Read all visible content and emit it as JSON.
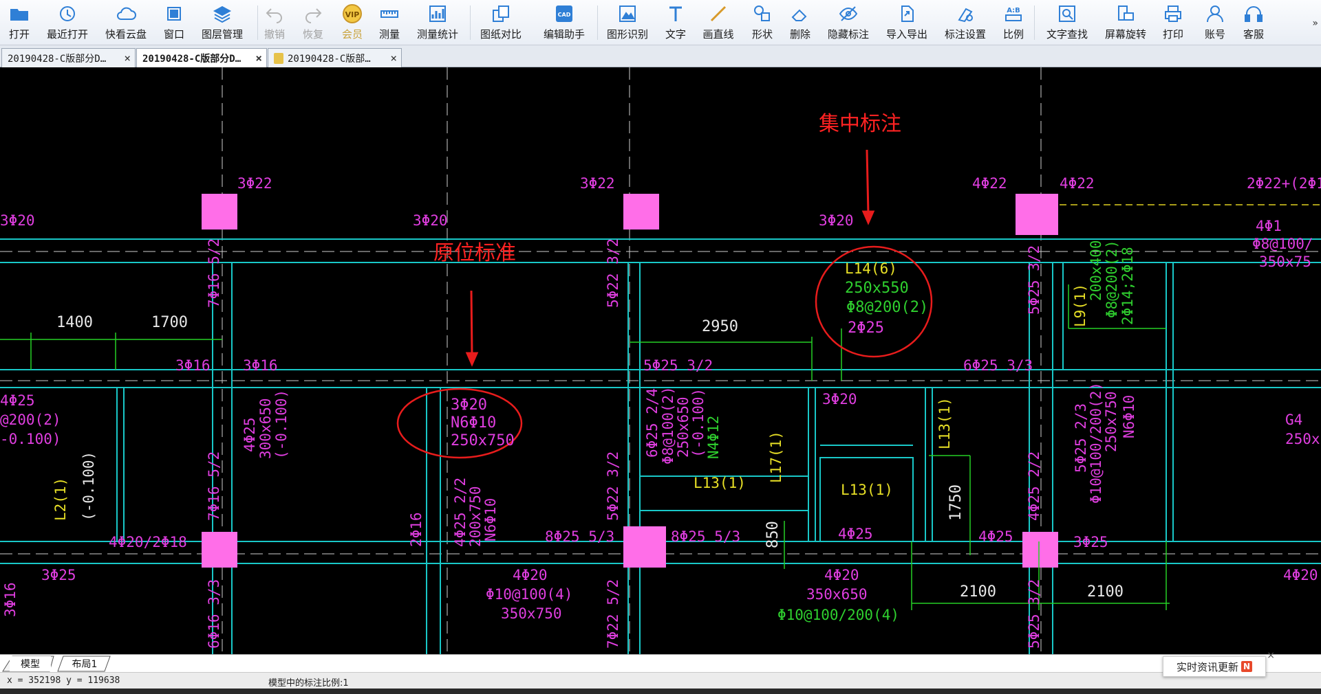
{
  "toolbar": {
    "buttons": [
      {
        "label": "打开",
        "icon": "folder-open-icon"
      },
      {
        "label": "最近打开",
        "icon": "history-icon"
      },
      {
        "label": "快看云盘",
        "icon": "cloud-icon"
      },
      {
        "label": "窗口",
        "icon": "window-icon"
      },
      {
        "label": "图层管理",
        "icon": "layers-icon"
      },
      {
        "label": "撤销",
        "icon": "undo-icon"
      },
      {
        "label": "恢复",
        "icon": "redo-icon"
      },
      {
        "label": "会员",
        "icon": "vip-icon",
        "badge": "VIP"
      },
      {
        "label": "测量",
        "icon": "ruler-icon"
      },
      {
        "label": "测量统计",
        "icon": "measure-stats-icon"
      },
      {
        "label": "图纸对比",
        "icon": "compare-icon"
      },
      {
        "label": "编辑助手",
        "icon": "cad-edit-icon",
        "badge": "CAD"
      },
      {
        "label": "图形识别",
        "icon": "shape-recognize-icon"
      },
      {
        "label": "文字",
        "icon": "text-icon"
      },
      {
        "label": "画直线",
        "icon": "line-icon"
      },
      {
        "label": "形状",
        "icon": "shapes-icon"
      },
      {
        "label": "删除",
        "icon": "eraser-icon"
      },
      {
        "label": "隐藏标注",
        "icon": "hide-eye-icon"
      },
      {
        "label": "导入导出",
        "icon": "import-export-icon"
      },
      {
        "label": "标注设置",
        "icon": "annotation-settings-icon"
      },
      {
        "label": "比例",
        "icon": "scale-icon",
        "badge": "A:B"
      },
      {
        "label": "文字查找",
        "icon": "text-search-icon"
      },
      {
        "label": "屏幕旋转",
        "icon": "rotate-screen-icon"
      },
      {
        "label": "打印",
        "icon": "printer-icon"
      },
      {
        "label": "账号",
        "icon": "user-icon"
      },
      {
        "label": "客服",
        "icon": "headset-icon"
      }
    ],
    "more_glyph": "»",
    "colors": {
      "icon_blue": "#2f7fd6",
      "disabled": "#a0a0a0",
      "vip_gold": "#c9a23a"
    }
  },
  "tabs": [
    {
      "title": "20190428-C版部分D…",
      "close": "×",
      "active": false,
      "locked": false
    },
    {
      "title": "20190428-C版部分D…",
      "close": "×",
      "active": true,
      "locked": false
    },
    {
      "title": "20190428-C版部…",
      "close": "×",
      "active": false,
      "locked": true
    }
  ],
  "drawing": {
    "annotations": [
      {
        "text": "集中标注",
        "color": "#ff2222"
      },
      {
        "text": "原位标准",
        "color": "#ff2222"
      }
    ],
    "labels": {
      "top_left_rebar_1": "3Φ22",
      "top_mid_rebar": "3Φ22",
      "top_right_rebar_1": "4Φ22",
      "top_right_rebar_2": "4Φ22",
      "top_far_right": "2Φ22+(2Φ1",
      "left_3f20": "3Φ20",
      "mid_3f20": "3Φ20",
      "right_3f20": "3Φ20",
      "col1_v": "7Φ16 5/2",
      "col2_v": "5Φ22 3/2",
      "col3_v": "5Φ25 3/2",
      "dim_1400": "1400",
      "dim_1700": "1700",
      "dim_2950": "2950",
      "l14_1": "L14(6)",
      "l14_2": "250x550",
      "l14_3": "Φ8@200(2)",
      "l14_4": "2Φ25",
      "l9_1": "L9(1)",
      "l9_2": "200x400",
      "l9_3": "Φ8@200(2)",
      "l9_4": "2Φ14;2Φ18",
      "right_4f1": "4Φ1",
      "right_f8": "Φ8@100/",
      "right_350": "350x75",
      "mid_3f16_a": "3Φ16",
      "mid_3f16_b": "3Φ16",
      "mid_5f25": "5Φ25 3/2",
      "mid_6f25": "6Φ25 3/3",
      "left_4f25": "4Φ25",
      "left_f200": "@200(2)",
      "left_0100": "-0.100)",
      "circ2_1": "3Φ20",
      "circ2_2": "N6Φ10",
      "circ2_3": "250x750",
      "col1_4f25": "4Φ25",
      "col1_300": "300x650",
      "col1_0100": "(-0.100)",
      "beam_mid_6f25": "6Φ25 2/4",
      "beam_mid_f8": "Φ8@100(2)",
      "beam_mid_250": "250x650",
      "beam_mid_0100": "(-0.100)",
      "beam_mid_n4": "N4Φ12",
      "mid_3f20_b": "3Φ20",
      "l13_a": "L13(1)",
      "l17": "L17(1)",
      "l13_b": "L13(1)",
      "l13_c": "L13(1)",
      "right_5f25": "5Φ25 2/3",
      "right_f10": "Φ10@100/200(2)",
      "right_250": "250x750",
      "right_n6": "N6Φ10",
      "far_right_g4": "G4",
      "far_right_250": "250x",
      "l2_1": "L2(1)",
      "l2_2": "(-0.100)",
      "col1_v2": "7Φ16 5/2",
      "col2_v2": "5Φ22 3/2",
      "col3_v2": "4Φ25 2/2",
      "left_4f20": "4Φ20/2Φ18",
      "mid_2f16": "2Φ16",
      "mid_4f25": "4Φ25 2/2",
      "mid_200": "200x750",
      "mid_n6": "N6Φ10",
      "bot_8f25a": "8Φ25 5/3",
      "bot_8f25b": "8Φ25 5/3",
      "dim_850": "850",
      "bot_4f25a": "4Φ25",
      "dim_1750": "1750",
      "bot_4f25b": "4Φ25",
      "bot_3f25": "3Φ25",
      "left_3f25": "3Φ25",
      "left_3f16": "3Φ16",
      "bot_4f20a": "4Φ20",
      "bot_f10a": "Φ10@100(4)",
      "bot_350a": "350x750",
      "bot_4f20b": "4Φ20",
      "bot_350b": "350x650",
      "bot_f10b": "Φ10@100/200(4)",
      "dim_2100a": "2100",
      "dim_2100b": "2100",
      "bot_4f20c": "4Φ20",
      "col1_v3": "6Φ16 3/3",
      "col2_v3": "7Φ22 5/2",
      "col3_v3": "5Φ25 3/2",
      "left_5f25": "3Φ16"
    }
  },
  "layout_tabs": [
    {
      "label": "模型",
      "active": true
    },
    {
      "label": "布局1",
      "active": false
    }
  ],
  "status": {
    "coords": "x = 352198 y = 119638",
    "scale": "模型中的标注比例:1"
  },
  "news": {
    "label": "实时资讯更新",
    "badge": "N",
    "close": "×"
  }
}
